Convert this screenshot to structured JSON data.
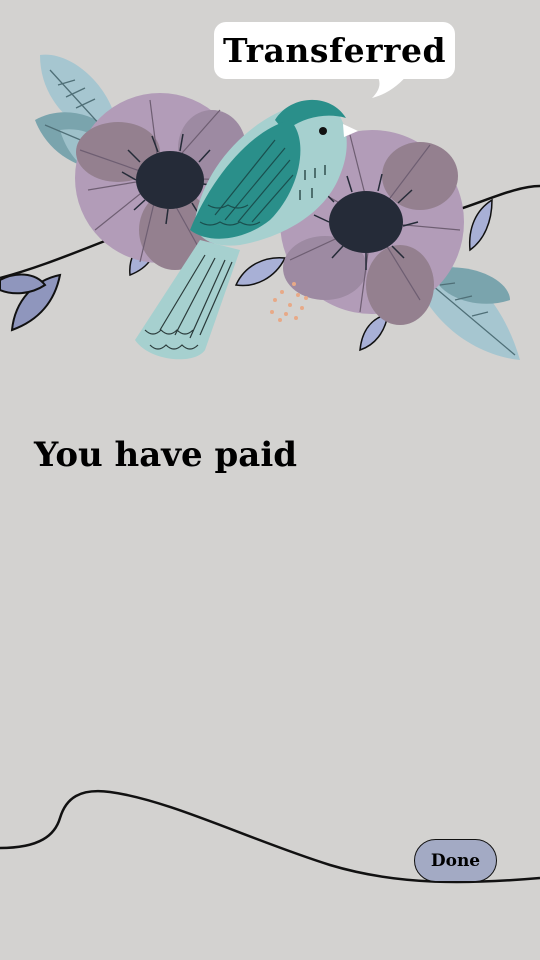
{
  "status": {
    "bubble_text": "Transferred"
  },
  "main": {
    "headline": "You have paid"
  },
  "actions": {
    "done_label": "Done"
  },
  "colors": {
    "background": "#d3d2d0",
    "button_fill": "#a3aac4",
    "bird_teal": "#2a8f8a",
    "flower_purple": "#b29cb8"
  },
  "illustration": {
    "subject": "bird-on-flowering-branch"
  }
}
